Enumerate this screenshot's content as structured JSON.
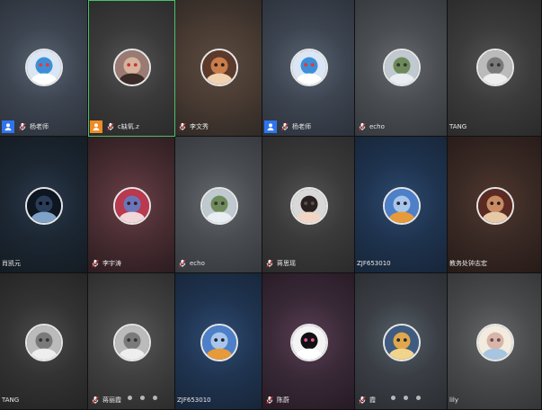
{
  "tiles": [
    {
      "name": "杨老师",
      "badge": "host",
      "mic": true,
      "avatar": "doraemon-avatar",
      "colors": [
        "#3d4551",
        "#5a6473",
        "#2c323b"
      ]
    },
    {
      "name": "c缺氧.z",
      "badge": "cohost",
      "mic": true,
      "active": true,
      "avatar": "cartoon-avatar",
      "colors": [
        "#3a3a3a",
        "#555",
        "#2a2a2a"
      ]
    },
    {
      "name": "李文秀",
      "badge": null,
      "mic": true,
      "avatar": "portrait-avatar",
      "colors": [
        "#4a3c33",
        "#5c4c42",
        "#2f2925"
      ]
    },
    {
      "name": "杨老师",
      "badge": "host",
      "mic": true,
      "avatar": "doraemon-avatar",
      "colors": [
        "#3d4551",
        "#5a6473",
        "#2c323b"
      ]
    },
    {
      "name": "echo",
      "badge": null,
      "mic": true,
      "avatar": "landscape-avatar",
      "colors": [
        "#4a4d52",
        "#66696e",
        "#35383c"
      ]
    },
    {
      "name": "TANG",
      "badge": null,
      "mic": false,
      "avatar": "bw-avatar",
      "colors": [
        "#3b3b3b",
        "#555",
        "#2a2a2a"
      ]
    },
    {
      "name": "肖凯元",
      "badge": null,
      "mic": false,
      "avatar": "dark-avatar",
      "colors": [
        "#1c2733",
        "#2c3a4c",
        "#141b22"
      ]
    },
    {
      "name": "李宇涛",
      "badge": null,
      "mic": true,
      "avatar": "red-avatar",
      "colors": [
        "#4a2e33",
        "#6b4048",
        "#2c1c20"
      ]
    },
    {
      "name": "echo",
      "badge": null,
      "mic": true,
      "avatar": "landscape-avatar",
      "colors": [
        "#4a4d52",
        "#66696e",
        "#35383c"
      ]
    },
    {
      "name": "蒋思瑶",
      "badge": null,
      "mic": true,
      "avatar": "woman-avatar",
      "colors": [
        "#3b3a3a",
        "#555454",
        "#2b2a2a"
      ]
    },
    {
      "name": "ZJF653010",
      "badge": null,
      "mic": false,
      "avatar": "sky-avatar",
      "colors": [
        "#1f3450",
        "#2e4b70",
        "#172538"
      ]
    },
    {
      "name": "教务处钟志宏",
      "badge": null,
      "mic": false,
      "avatar": "warm-avatar",
      "colors": [
        "#3a2a25",
        "#52392f",
        "#261b18"
      ]
    },
    {
      "name": "TANG",
      "badge": null,
      "mic": false,
      "avatar": "bw-avatar",
      "colors": [
        "#333",
        "#4c4c4c",
        "#242424"
      ]
    },
    {
      "name": "蒋丽霞",
      "badge": null,
      "mic": true,
      "avatar": "bw-avatar",
      "colors": [
        "#404040",
        "#5a5a5a",
        "#2c2c2c"
      ]
    },
    {
      "name": "ZJF653010",
      "badge": null,
      "mic": false,
      "avatar": "sky-avatar",
      "colors": [
        "#203552",
        "#2f4d74",
        "#172538"
      ]
    },
    {
      "name": "陈蔚",
      "badge": null,
      "mic": true,
      "avatar": "panda-avatar",
      "colors": [
        "#3a2a38",
        "#5a3e55",
        "#261a24"
      ]
    },
    {
      "name": "霞",
      "badge": null,
      "mic": true,
      "avatar": "city-avatar",
      "colors": [
        "#3b3f45",
        "#55606a",
        "#2a2e33"
      ]
    },
    {
      "name": "lily",
      "badge": null,
      "mic": false,
      "avatar": "anime-avatar",
      "colors": [
        "#4a4b4d",
        "#66686a",
        "#333537"
      ]
    }
  ],
  "pagination": [
    {
      "tile": 13,
      "count": 3
    },
    {
      "tile": 16,
      "count": 3
    }
  ]
}
